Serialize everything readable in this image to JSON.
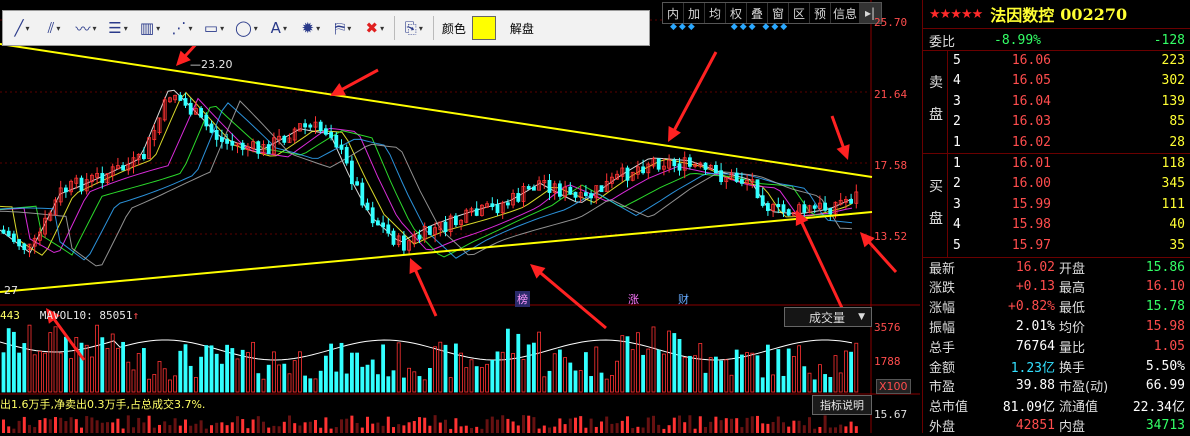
{
  "toolbar": {
    "tools": [
      {
        "name": "line-tool-icon",
        "glyph": "╱"
      },
      {
        "name": "multi-line-tool-icon",
        "glyph": "⫽"
      },
      {
        "name": "wave-tool-icon",
        "glyph": "〰"
      },
      {
        "name": "fib-tool-icon",
        "glyph": "☰"
      },
      {
        "name": "vertical-lines-tool-icon",
        "glyph": "▥"
      },
      {
        "name": "channel-tool-icon",
        "glyph": "⋰"
      },
      {
        "name": "rectangle-tool-icon",
        "glyph": "▭"
      },
      {
        "name": "ellipse-tool-icon",
        "glyph": "◯"
      },
      {
        "name": "text-tool-icon",
        "glyph": "A"
      },
      {
        "name": "gear-icon",
        "glyph": "✹"
      },
      {
        "name": "stamp-tool-icon",
        "glyph": "⛿"
      },
      {
        "name": "delete-icon",
        "glyph": "✖"
      },
      {
        "name": "export-icon",
        "glyph": "⎘"
      }
    ],
    "color_label": "颜色",
    "color_value": "#ffff00",
    "unlock_label": "解盘"
  },
  "indicator_tabs": [
    "内",
    "加",
    "均",
    "权",
    "叠",
    "窗",
    "区",
    "预",
    "信息"
  ],
  "price_axis": [
    "25.70",
    "21.64",
    "17.58",
    "13.52"
  ],
  "volume_axis": [
    "3576",
    "1788"
  ],
  "lower_axis": "15.67",
  "x100_label": "X100",
  "high_annotation": "23.20",
  "left_low_label": "27",
  "volume_indicator": {
    "prefix": "443",
    "name": "MAVOL10:",
    "value": "85051",
    "arrow": "↑"
  },
  "volume_dropdown": "成交量",
  "flow_text": "出1.6万手,净卖出0.3万手,占总成交3.7%.",
  "help_label": "指标说明",
  "markers": {
    "bang": "榜",
    "zhang": "涨",
    "cai": "财"
  },
  "colors": {
    "up": "#ff3333",
    "down": "#33ffff",
    "trend": "#ffff00",
    "arrow": "#ff2222"
  },
  "stock": {
    "stars": "★★★★★",
    "name": "法因数控",
    "code": "002270"
  },
  "weibi": {
    "label": "委比",
    "pct": "-8.99%",
    "diff": "-128"
  },
  "sell": {
    "label_a": "卖",
    "label_b": "盘",
    "levels": [
      {
        "n": "5",
        "price": "16.06",
        "vol": "223"
      },
      {
        "n": "4",
        "price": "16.05",
        "vol": "302"
      },
      {
        "n": "3",
        "price": "16.04",
        "vol": "139"
      },
      {
        "n": "2",
        "price": "16.03",
        "vol": "85"
      },
      {
        "n": "1",
        "price": "16.02",
        "vol": "28"
      }
    ]
  },
  "buy": {
    "label_a": "买",
    "label_b": "盘",
    "levels": [
      {
        "n": "1",
        "price": "16.01",
        "vol": "118"
      },
      {
        "n": "2",
        "price": "16.00",
        "vol": "345"
      },
      {
        "n": "3",
        "price": "15.99",
        "vol": "111"
      },
      {
        "n": "4",
        "price": "15.98",
        "vol": "40"
      },
      {
        "n": "5",
        "price": "15.97",
        "vol": "35"
      }
    ]
  },
  "quote": [
    {
      "l1": "最新",
      "v1": "16.02",
      "c1": "red",
      "l2": "开盘",
      "v2": "15.86",
      "c2": "green"
    },
    {
      "l1": "涨跌",
      "v1": "+0.13",
      "c1": "red",
      "l2": "最高",
      "v2": "16.10",
      "c2": "red"
    },
    {
      "l1": "涨幅",
      "v1": "+0.82%",
      "c1": "red",
      "l2": "最低",
      "v2": "15.78",
      "c2": "green"
    },
    {
      "l1": "振幅",
      "v1": "2.01%",
      "c1": "white",
      "l2": "均价",
      "v2": "15.98",
      "c2": "red"
    },
    {
      "l1": "总手",
      "v1": "76764",
      "c1": "white",
      "l2": "量比",
      "v2": "1.05",
      "c2": "red"
    },
    {
      "l1": "金额",
      "v1": "1.23亿",
      "c1": "cyan",
      "l2": "换手",
      "v2": "5.50%",
      "c2": "white"
    },
    {
      "l1": "市盈",
      "v1": "39.88",
      "c1": "white",
      "l2": "市盈(动)",
      "v2": "66.99",
      "c2": "white"
    },
    {
      "l1": "总市值",
      "v1": "81.09亿",
      "c1": "white",
      "l2": "流通值",
      "v2": "22.34亿",
      "c2": "white"
    },
    {
      "l1": "外盘",
      "v1": "42851",
      "c1": "red",
      "l2": "内盘",
      "v2": "34713",
      "c2": "green"
    }
  ]
}
